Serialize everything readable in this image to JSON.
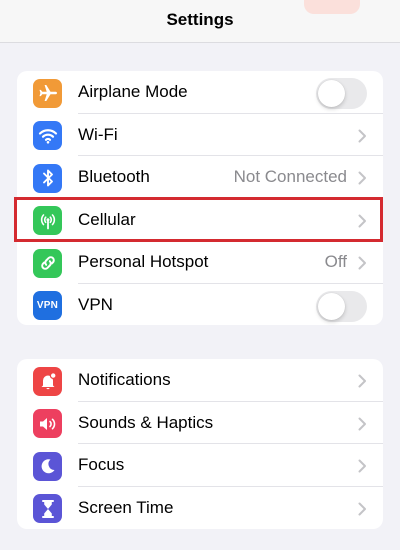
{
  "nav": {
    "title": "Settings"
  },
  "groups": {
    "connectivity": {
      "rows": [
        {
          "label": "Airplane Mode",
          "icon": "airplane-icon",
          "icon_color": "#f19a37",
          "accessory": "toggle",
          "toggle_on": false
        },
        {
          "label": "Wi-Fi",
          "icon": "wifi-icon",
          "icon_color": "#3478f6",
          "accessory": "chevron"
        },
        {
          "label": "Bluetooth",
          "icon": "bluetooth-icon",
          "icon_color": "#3478f6",
          "accessory": "chevron",
          "value": "Not Connected"
        },
        {
          "label": "Cellular",
          "icon": "cellular-antenna-icon",
          "icon_color": "#34c759",
          "accessory": "chevron",
          "highlighted": true
        },
        {
          "label": "Personal Hotspot",
          "icon": "hotspot-link-icon",
          "icon_color": "#34c759",
          "accessory": "chevron",
          "value": "Off"
        },
        {
          "label": "VPN",
          "icon": "vpn-icon",
          "icon_text": "VPN",
          "icon_color": "#1f6fe0",
          "accessory": "toggle",
          "toggle_on": false
        }
      ]
    },
    "notifications": {
      "rows": [
        {
          "label": "Notifications",
          "icon": "notifications-bell-icon",
          "icon_color": "#ee4545",
          "accessory": "chevron"
        },
        {
          "label": "Sounds & Haptics",
          "icon": "speaker-icon",
          "icon_color": "#ed3f5f",
          "accessory": "chevron"
        },
        {
          "label": "Focus",
          "icon": "moon-icon",
          "icon_color": "#5b55d6",
          "accessory": "chevron"
        },
        {
          "label": "Screen Time",
          "icon": "hourglass-icon",
          "icon_color": "#5b55d6",
          "accessory": "chevron"
        }
      ]
    }
  },
  "colors": {
    "highlight_border": "#d42a30",
    "chevron": "#c4c4c7",
    "secondary_text": "#8a8a8e"
  }
}
